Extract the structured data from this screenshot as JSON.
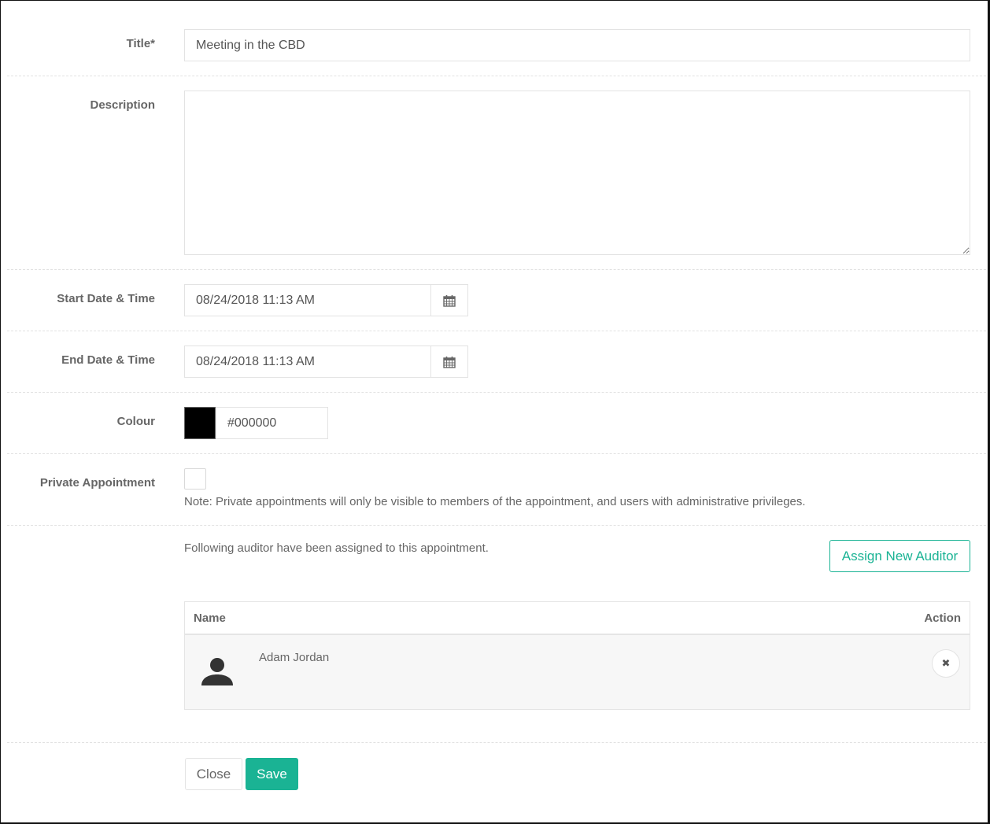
{
  "form": {
    "title": {
      "label": "Title*",
      "value": "Meeting in the CBD"
    },
    "description": {
      "label": "Description",
      "value": ""
    },
    "start": {
      "label": "Start Date & Time",
      "value": "08/24/2018 11:13 AM",
      "icon": "calendar-icon"
    },
    "end": {
      "label": "End Date & Time",
      "value": "08/24/2018 11:13 AM",
      "icon": "calendar-icon"
    },
    "colour": {
      "label": "Colour",
      "value": "#000000",
      "swatch": "#000000"
    },
    "private": {
      "label": "Private Appointment",
      "checked": false,
      "note": "Note: Private appointments will only be visible to members of the appointment, and users with administrative privileges."
    }
  },
  "auditors": {
    "intro": "Following auditor have been assigned to this appointment.",
    "assign_button": "Assign New Auditor",
    "columns": {
      "name": "Name",
      "action": "Action"
    },
    "rows": [
      {
        "name": "Adam Jordan",
        "avatar_icon": "user-icon",
        "remove_icon": "close-icon"
      }
    ]
  },
  "actions": {
    "close": "Close",
    "save": "Save"
  },
  "colors": {
    "accent": "#1ab394",
    "text": "#666666",
    "border": "#e3e3e3"
  }
}
